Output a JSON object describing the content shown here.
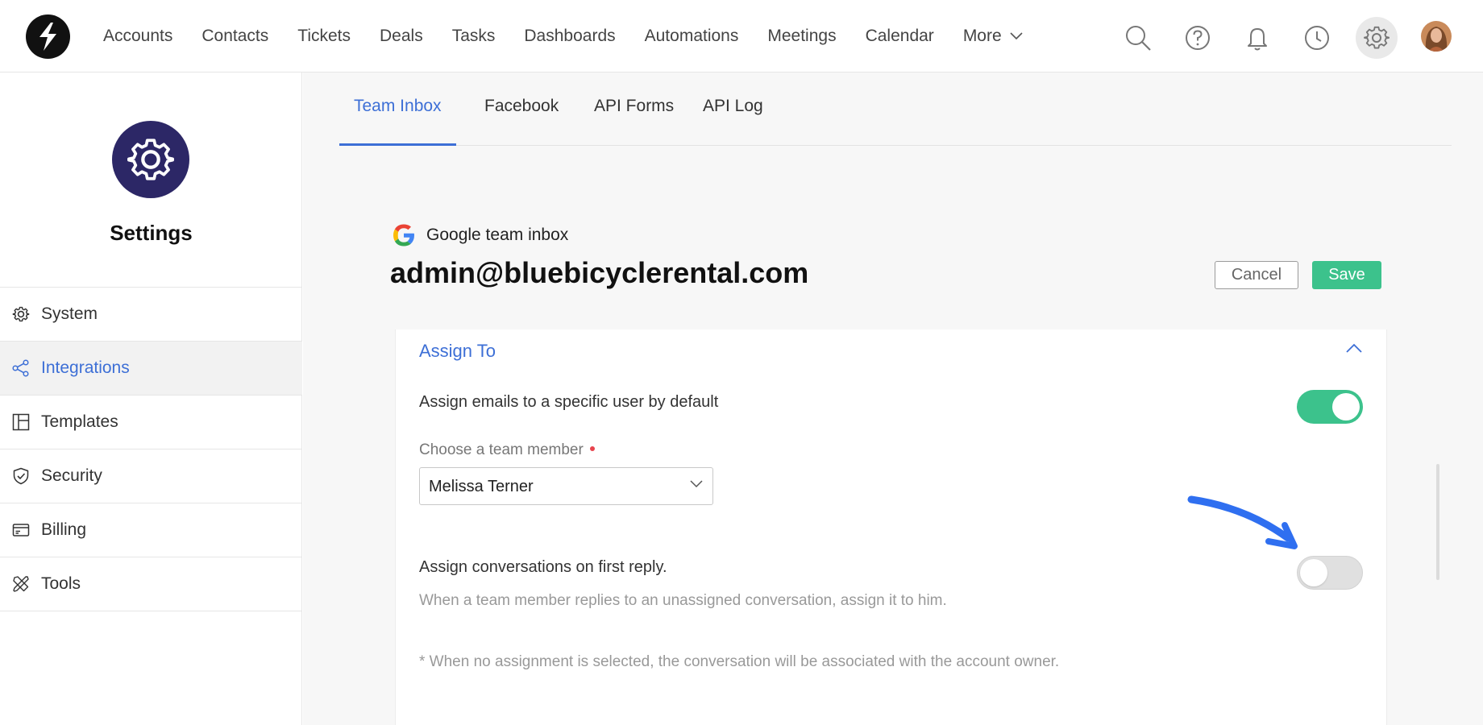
{
  "nav": {
    "items": [
      "Accounts",
      "Contacts",
      "Tickets",
      "Deals",
      "Tasks",
      "Dashboards",
      "Automations",
      "Meetings",
      "Calendar"
    ],
    "more_label": "More"
  },
  "top_icons": [
    "search-icon",
    "help-icon",
    "bell-icon",
    "clock-icon",
    "gear-icon"
  ],
  "sidebar": {
    "title": "Settings",
    "items": [
      {
        "label": "System",
        "icon": "gear-icon",
        "active": false
      },
      {
        "label": "Integrations",
        "icon": "share-icon",
        "active": true
      },
      {
        "label": "Templates",
        "icon": "layout-icon",
        "active": false
      },
      {
        "label": "Security",
        "icon": "shield-icon",
        "active": false
      },
      {
        "label": "Billing",
        "icon": "card-icon",
        "active": false
      },
      {
        "label": "Tools",
        "icon": "tools-icon",
        "active": false
      }
    ]
  },
  "tabs": [
    {
      "label": "Team Inbox",
      "active": true
    },
    {
      "label": "Facebook",
      "active": false
    },
    {
      "label": "API Forms",
      "active": false
    },
    {
      "label": "API Log",
      "active": false
    }
  ],
  "inbox": {
    "type_label": "Google team inbox",
    "email": "admin@bluebicyclerental.com"
  },
  "actions": {
    "cancel_label": "Cancel",
    "save_label": "Save"
  },
  "assign_section": {
    "title": "Assign To",
    "default_user_label": "Assign emails to a specific user by default",
    "default_user_enabled": true,
    "team_member_label": "Choose a team member",
    "team_member_value": "Melissa Terner",
    "first_reply_label": "Assign conversations on first reply.",
    "first_reply_enabled": false,
    "first_reply_help": "When a team member replies to an unassigned conversation, assign it to him.",
    "footnote": "* When no assignment is selected, the conversation will be associated with the account owner."
  },
  "colors": {
    "accent": "#3d6fd6",
    "save_green": "#3cc28c",
    "settings_badge": "#2c2766",
    "annotation_arrow": "#2f6ff0"
  }
}
